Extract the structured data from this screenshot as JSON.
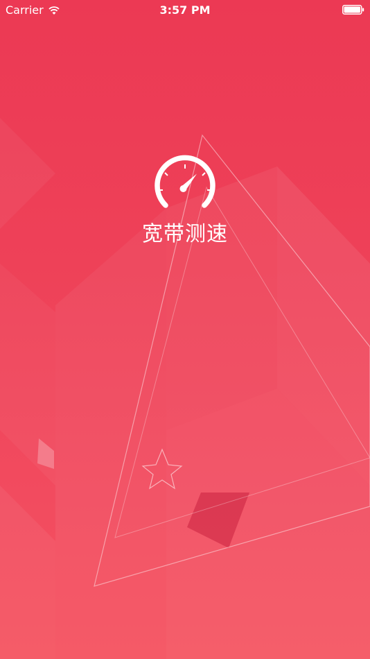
{
  "status_bar": {
    "carrier": "Carrier",
    "time": "3:57 PM",
    "wifi_icon": "wifi-icon",
    "battery_icon": "battery-icon"
  },
  "splash": {
    "logo_icon": "speedometer-icon",
    "title": "宽带测速"
  },
  "colors": {
    "background_top": "#ec3954",
    "background_bottom": "#f5525f",
    "foreground": "#ffffff"
  }
}
